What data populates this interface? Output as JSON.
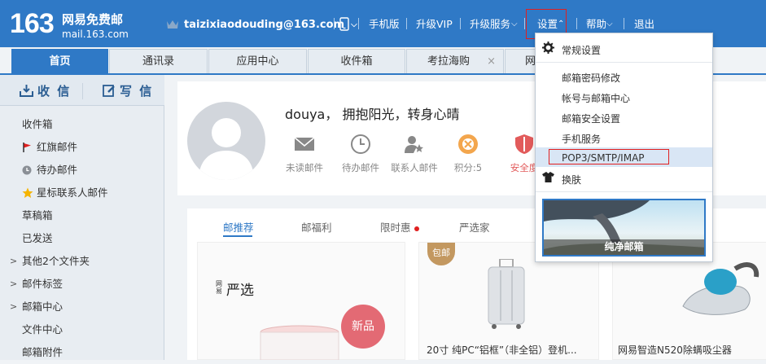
{
  "header": {
    "logo_number": "163",
    "logo_cn": "网易免费邮",
    "logo_en": "mail.163.com",
    "user_email": "taizixiaodouding@163.com",
    "links": {
      "mobile": "手机版",
      "vip": "升级VIP",
      "upgrade_service": "升级服务",
      "settings": "设置",
      "help": "帮助",
      "logout": "退出"
    }
  },
  "tabs": [
    "首页",
    "通讯录",
    "应用中心",
    "收件箱",
    "考拉海购",
    "网"
  ],
  "sidebar": {
    "receive": "收 信",
    "compose": "写 信",
    "items": [
      {
        "label": "收件箱"
      },
      {
        "label": "红旗邮件"
      },
      {
        "label": "待办邮件"
      },
      {
        "label": "星标联系人邮件"
      },
      {
        "label": "草稿箱"
      },
      {
        "label": "已发送"
      },
      {
        "label": "其他2个文件夹"
      },
      {
        "label": "邮件标签"
      },
      {
        "label": "邮箱中心"
      },
      {
        "label": "文件中心"
      },
      {
        "label": "邮箱附件"
      }
    ]
  },
  "profile": {
    "greeting": "douya， 拥抱阳光，转身心晴",
    "stats": [
      "未读邮件",
      "待办邮件",
      "联系人邮件",
      "积分:5",
      "安全度"
    ]
  },
  "promo": {
    "tabs": [
      "邮推荐",
      "邮福利",
      "限时惠",
      "严选家"
    ],
    "yanxuan_small": "网易",
    "yanxuan_big": "严选",
    "new_badge": "新品",
    "baoyou_badge": "包邮",
    "item1": "20寸 纯PC“铝框”（非全铝）登机...",
    "item2": "网易智造N520除螨吸尘器"
  },
  "dropdown": {
    "general": "常规设置",
    "items": [
      "邮箱密码修改",
      "帐号与邮箱中心",
      "邮箱安全设置",
      "手机服务",
      "POP3/SMTP/IMAP"
    ],
    "skin": "换肤",
    "banner": "纯净邮箱"
  },
  "colors": {
    "brand_blue": "#2f79c6",
    "highlight_red": "#e02020"
  }
}
